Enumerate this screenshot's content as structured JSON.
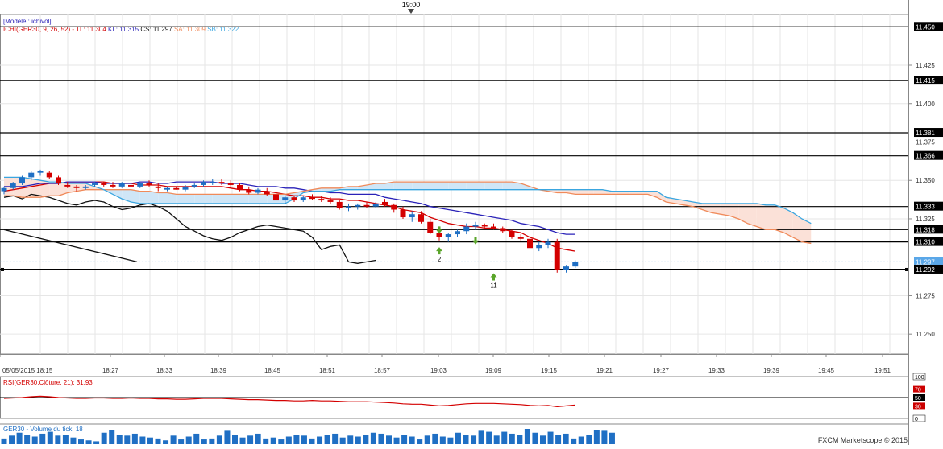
{
  "app": {
    "footer": "FXCM Marketscope © 2015"
  },
  "header": {
    "time_marker": "19:00"
  },
  "main_panel": {
    "model_label": "[Modèle : ichivol]",
    "legend": [
      {
        "text": "ICHI(GER30, 9, 26, 52) - TL: 11.304",
        "color": "#d40000"
      },
      {
        "text": "KL: 11.315",
        "color": "#2a22b8"
      },
      {
        "text": "CS: 11.297",
        "color": "#111111"
      },
      {
        "text": "SA: 11.309",
        "color": "#f08a5a"
      },
      {
        "text": "SB: 11.322",
        "color": "#3aa6e0"
      }
    ],
    "arrow_labels": [
      "2",
      "11"
    ]
  },
  "rsi_panel": {
    "label": "RSI(GER30.Clôture, 21): 31,93",
    "levels": [
      "100",
      "70",
      "50",
      "30",
      "0"
    ]
  },
  "volume_panel": {
    "label": "GER30 - Volume du tick: 18"
  },
  "colors": {
    "bull": "#1f6fc4",
    "bear": "#d40000",
    "cloud_bull": "#cfe6f7",
    "cloud_bear": "#fbe1d8"
  },
  "chart_data": {
    "type": "candlestick",
    "symbol": "GER30",
    "x_tick_labels": [
      "05/05/2015 18:15",
      "18:27",
      "18:33",
      "18:39",
      "18:45",
      "18:51",
      "18:57",
      "19:03",
      "19:09",
      "19:15",
      "19:21",
      "19:27",
      "19:33",
      "19:39",
      "19:45",
      "19:51"
    ],
    "y_tick_labels": [
      "11.450",
      "11.425",
      "11.415",
      "11.400",
      "11.381",
      "11.375",
      "11.366",
      "11.350",
      "11.333",
      "11.325",
      "11.318",
      "11.310",
      "11.297",
      "11.292",
      "11.275",
      "11.250"
    ],
    "ylim": [
      11237,
      11458
    ],
    "horizontal_levels": [
      11450,
      11415,
      11381,
      11366,
      11333,
      11318,
      11310,
      11292
    ],
    "price_marker": 11297,
    "candles": [
      [
        11343,
        11346,
        11341,
        11345
      ],
      [
        11345,
        11349,
        11344,
        11348
      ],
      [
        11348,
        11353,
        11347,
        11352
      ],
      [
        11352,
        11356,
        11350,
        11355
      ],
      [
        11355,
        11357,
        11353,
        11356
      ],
      [
        11355,
        11356,
        11351,
        11352
      ],
      [
        11352,
        11353,
        11347,
        11348
      ],
      [
        11347,
        11349,
        11345,
        11346
      ],
      [
        11346,
        11347,
        11343,
        11345
      ],
      [
        11345,
        11347,
        11344,
        11346
      ],
      [
        11347,
        11349,
        11346,
        11348
      ],
      [
        11348,
        11349,
        11346,
        11347
      ],
      [
        11347,
        11349,
        11345,
        11346
      ],
      [
        11346,
        11349,
        11345,
        11348
      ],
      [
        11347,
        11349,
        11345,
        11346
      ],
      [
        11346,
        11349,
        11345,
        11348
      ],
      [
        11348,
        11350,
        11346,
        11347
      ],
      [
        11346,
        11348,
        11343,
        11345
      ],
      [
        11344,
        11346,
        11343,
        11345
      ],
      [
        11345,
        11346,
        11344,
        11344
      ],
      [
        11344,
        11347,
        11343,
        11346
      ],
      [
        11346,
        11348,
        11345,
        11347
      ],
      [
        11347,
        11350,
        11346,
        11349
      ],
      [
        11349,
        11351,
        11347,
        11349
      ],
      [
        11349,
        11351,
        11347,
        11348
      ],
      [
        11348,
        11350,
        11346,
        11347
      ],
      [
        11347,
        11348,
        11343,
        11344
      ],
      [
        11344,
        11346,
        11341,
        11342
      ],
      [
        11342,
        11345,
        11341,
        11344
      ],
      [
        11343,
        11345,
        11340,
        11341
      ],
      [
        11341,
        11342,
        11336,
        11337
      ],
      [
        11337,
        11340,
        11335,
        11339
      ],
      [
        11339,
        11340,
        11336,
        11337
      ],
      [
        11337,
        11340,
        11336,
        11339
      ],
      [
        11339,
        11341,
        11337,
        11338
      ],
      [
        11338,
        11340,
        11336,
        11337
      ],
      [
        11337,
        11339,
        11335,
        11336
      ],
      [
        11336,
        11337,
        11331,
        11332
      ],
      [
        11332,
        11335,
        11330,
        11333
      ],
      [
        11333,
        11335,
        11331,
        11334
      ],
      [
        11334,
        11336,
        11332,
        11333
      ],
      [
        11333,
        11336,
        11332,
        11335
      ],
      [
        11336,
        11338,
        11333,
        11334
      ],
      [
        11334,
        11335,
        11329,
        11331
      ],
      [
        11331,
        11333,
        11325,
        11326
      ],
      [
        11326,
        11330,
        11323,
        11328
      ],
      [
        11328,
        11330,
        11322,
        11323
      ],
      [
        11323,
        11325,
        11315,
        11316
      ],
      [
        11316,
        11318,
        11311,
        11313
      ],
      [
        11313,
        11316,
        11310,
        11315
      ],
      [
        11315,
        11318,
        11313,
        11317
      ],
      [
        11317,
        11322,
        11315,
        11320
      ],
      [
        11320,
        11323,
        11318,
        11321
      ],
      [
        11321,
        11322,
        11319,
        11320
      ],
      [
        11320,
        11322,
        11318,
        11319
      ],
      [
        11319,
        11320,
        11316,
        11317
      ],
      [
        11317,
        11318,
        11312,
        11313
      ],
      [
        11313,
        11315,
        11311,
        11312
      ],
      [
        11312,
        11313,
        11305,
        11306
      ],
      [
        11306,
        11310,
        11304,
        11308
      ],
      [
        11308,
        11312,
        11306,
        11310
      ],
      [
        11310,
        11312,
        11290,
        11292
      ],
      [
        11292,
        11295,
        11290,
        11294
      ],
      [
        11294,
        11298,
        11293,
        11297
      ]
    ],
    "series": [
      {
        "name": "TL",
        "color": "#d40000",
        "values": [
          11343,
          11344,
          11345,
          11346,
          11347,
          11348,
          11348,
          11349,
          11349,
          11349,
          11349,
          11349,
          11348,
          11348,
          11348,
          11347,
          11347,
          11347,
          11346,
          11346,
          11346,
          11346,
          11346,
          11346,
          11346,
          11345,
          11344,
          11344,
          11343,
          11343,
          11342,
          11341,
          11340,
          11340,
          11339,
          11339,
          11338,
          11338,
          11337,
          11337,
          11336,
          11335,
          11334,
          11333,
          11331,
          11330,
          11329,
          11326,
          11324,
          11322,
          11321,
          11320,
          11320,
          11319,
          11319,
          11318,
          11317,
          11316,
          11313,
          11311,
          11309,
          11306,
          11305,
          11304
        ]
      },
      {
        "name": "KL",
        "color": "#2a22b8",
        "values": [
          11346,
          11346,
          11346,
          11347,
          11348,
          11348,
          11348,
          11349,
          11349,
          11349,
          11349,
          11348,
          11348,
          11348,
          11348,
          11349,
          11349,
          11348,
          11348,
          11349,
          11349,
          11349,
          11349,
          11349,
          11348,
          11348,
          11348,
          11347,
          11346,
          11346,
          11346,
          11345,
          11345,
          11344,
          11343,
          11343,
          11342,
          11342,
          11341,
          11341,
          11341,
          11341,
          11339,
          11338,
          11337,
          11336,
          11335,
          11333,
          11332,
          11331,
          11330,
          11329,
          11328,
          11327,
          11326,
          11325,
          11324,
          11322,
          11321,
          11320,
          11318,
          11316,
          11315,
          11315
        ]
      },
      {
        "name": "CS",
        "color": "#111111",
        "values": [
          11339,
          11340,
          11338,
          11341,
          11340,
          11339,
          11337,
          11335,
          11334,
          11336,
          11337,
          11336,
          11333,
          11331,
          11332,
          11334,
          11335,
          11333,
          11330,
          11325,
          11320,
          11317,
          11314,
          11312,
          11311,
          11313,
          11316,
          11318,
          11320,
          11321,
          11320,
          11319,
          11318,
          11317,
          11313,
          11305,
          11307,
          11308,
          11297,
          11296,
          11297,
          11298
        ]
      },
      {
        "name": "SA",
        "color": "#f08a5a",
        "values": [
          11340,
          11340,
          11339,
          11339,
          11339,
          11340,
          11340,
          11342,
          11343,
          11344,
          11344,
          11344,
          11344,
          11344,
          11344,
          11343,
          11343,
          11342,
          11342,
          11341,
          11341,
          11341,
          11341,
          11341,
          11341,
          11341,
          11341,
          11341,
          11341,
          11341,
          11341,
          11341,
          11342,
          11343,
          11344,
          11345,
          11345,
          11345,
          11346,
          11346,
          11347,
          11348,
          11348,
          11349,
          11349,
          11349,
          11349,
          11349,
          11349,
          11349,
          11349,
          11349,
          11349,
          11349,
          11349,
          11349,
          11349,
          11348,
          11346,
          11344,
          11343,
          11342,
          11342,
          11341,
          11341,
          11341,
          11341,
          11341,
          11341,
          11341,
          11341,
          11341,
          11339,
          11336,
          11335,
          11334,
          11333,
          11331,
          11329,
          11328,
          11327,
          11325,
          11322,
          11320,
          11318,
          11318,
          11316,
          11313,
          11310,
          11309
        ]
      },
      {
        "name": "SB",
        "color": "#3aa6e0",
        "values": [
          11352,
          11352,
          11352,
          11351,
          11350,
          11349,
          11349,
          11348,
          11348,
          11348,
          11346,
          11344,
          11341,
          11338,
          11336,
          11335,
          11335,
          11335,
          11335,
          11335,
          11335,
          11335,
          11335,
          11335,
          11335,
          11335,
          11335,
          11335,
          11335,
          11335,
          11335,
          11335,
          11338,
          11342,
          11343,
          11343,
          11343,
          11344,
          11344,
          11344,
          11344,
          11344,
          11344,
          11344,
          11344,
          11344,
          11344,
          11344,
          11344,
          11344,
          11344,
          11344,
          11344,
          11344,
          11344,
          11344,
          11344,
          11344,
          11344,
          11344,
          11344,
          11344,
          11344,
          11344,
          11344,
          11344,
          11344,
          11343,
          11343,
          11343,
          11343,
          11343,
          11343,
          11339,
          11338,
          11337,
          11336,
          11335,
          11335,
          11335,
          11335,
          11335,
          11335,
          11335,
          11334,
          11334,
          11332,
          11329,
          11325,
          11322
        ]
      }
    ],
    "trend_line": [
      [
        0,
        11318
      ],
      [
        12,
        11297
      ]
    ],
    "arrows": [
      {
        "index": 48,
        "value": 11318,
        "dir": "down",
        "label": ""
      },
      {
        "index": 48,
        "value": 11304,
        "dir": "up",
        "label": "2"
      },
      {
        "index": 52,
        "value": 11311,
        "dir": "down",
        "label": ""
      },
      {
        "index": 54,
        "value": 11287,
        "dir": "up",
        "label": "11"
      }
    ],
    "rsi": {
      "ylim": [
        0,
        100
      ],
      "levels": [
        70,
        50,
        30
      ],
      "values": [
        48,
        49,
        50,
        52,
        53,
        52,
        50,
        49,
        48,
        48,
        49,
        49,
        48,
        48,
        49,
        48,
        48,
        47,
        47,
        46,
        46,
        47,
        48,
        48,
        48,
        47,
        46,
        45,
        45,
        44,
        43,
        43,
        42,
        42,
        43,
        42,
        42,
        41,
        40,
        40,
        40,
        39,
        38,
        37,
        35,
        34,
        34,
        32,
        30,
        31,
        33,
        35,
        36,
        36,
        36,
        35,
        34,
        33,
        31,
        30,
        31,
        28,
        30,
        32
      ]
    },
    "volume": {
      "values": [
        6,
        9,
        12,
        10,
        8,
        11,
        13,
        9,
        10,
        7,
        5,
        4,
        3,
        12,
        15,
        10,
        9,
        11,
        8,
        7,
        6,
        4,
        9,
        5,
        8,
        11,
        5,
        6,
        9,
        14,
        10,
        7,
        9,
        11,
        6,
        7,
        5,
        8,
        10,
        9,
        6,
        8,
        10,
        11,
        7,
        9,
        8,
        10,
        12,
        11,
        9,
        7,
        10,
        8,
        5,
        9,
        11,
        8,
        7,
        12,
        10,
        9,
        14,
        13,
        9,
        13,
        11,
        10,
        16,
        12,
        9,
        13,
        10,
        11,
        6,
        8,
        10,
        15,
        14,
        12
      ]
    }
  }
}
